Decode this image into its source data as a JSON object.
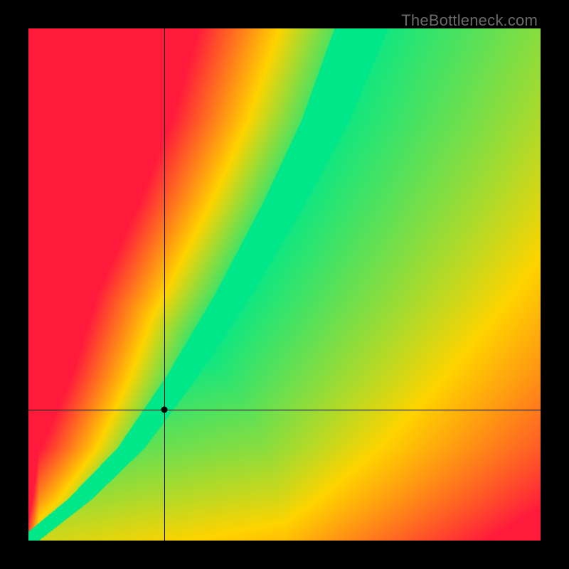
{
  "watermark": "TheBottleneck.com",
  "chart_data": {
    "type": "heatmap",
    "title": "",
    "xlabel": "",
    "ylabel": "",
    "xlim": [
      0,
      1
    ],
    "ylim": [
      0,
      1
    ],
    "description": "Bottleneck heatmap. Optimal (green) region is a narrow curved band from lower-left to upper-right with slope >1, meaning the y value must grow faster than x for balance. Red = severe mismatch, yellow/orange = moderate.",
    "optimal_band": {
      "control_points_xy": [
        [
          0.0,
          0.0
        ],
        [
          0.1,
          0.08
        ],
        [
          0.2,
          0.18
        ],
        [
          0.3,
          0.32
        ],
        [
          0.4,
          0.48
        ],
        [
          0.5,
          0.66
        ],
        [
          0.58,
          0.82
        ],
        [
          0.65,
          1.0
        ]
      ],
      "band_halfwidth_x": 0.035
    },
    "crosshair": {
      "x": 0.265,
      "y": 0.255
    },
    "marker": {
      "x": 0.265,
      "y": 0.255
    },
    "colorscale": [
      {
        "stop": 0.0,
        "color": "#ff1a3c"
      },
      {
        "stop": 0.5,
        "color": "#ffd400"
      },
      {
        "stop": 1.0,
        "color": "#00e88a"
      }
    ]
  }
}
